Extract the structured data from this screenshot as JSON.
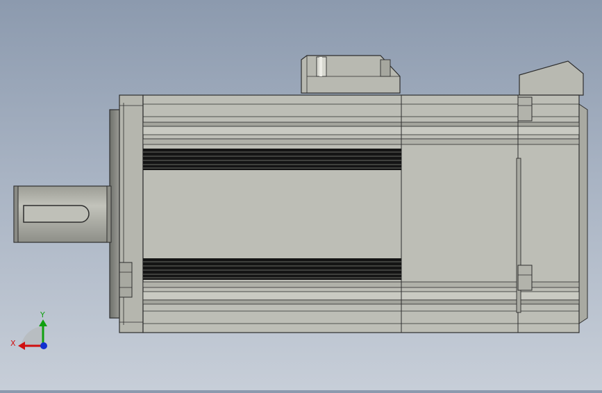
{
  "viewport": {
    "background_top": "#8c9aae",
    "background_bottom": "#c7ced8",
    "model": "servo-motor-side-view"
  },
  "triad": {
    "x_label": "X",
    "y_label": "Y",
    "x_color": "#d01010",
    "y_color": "#10a010",
    "z_color": "#1030d0"
  }
}
